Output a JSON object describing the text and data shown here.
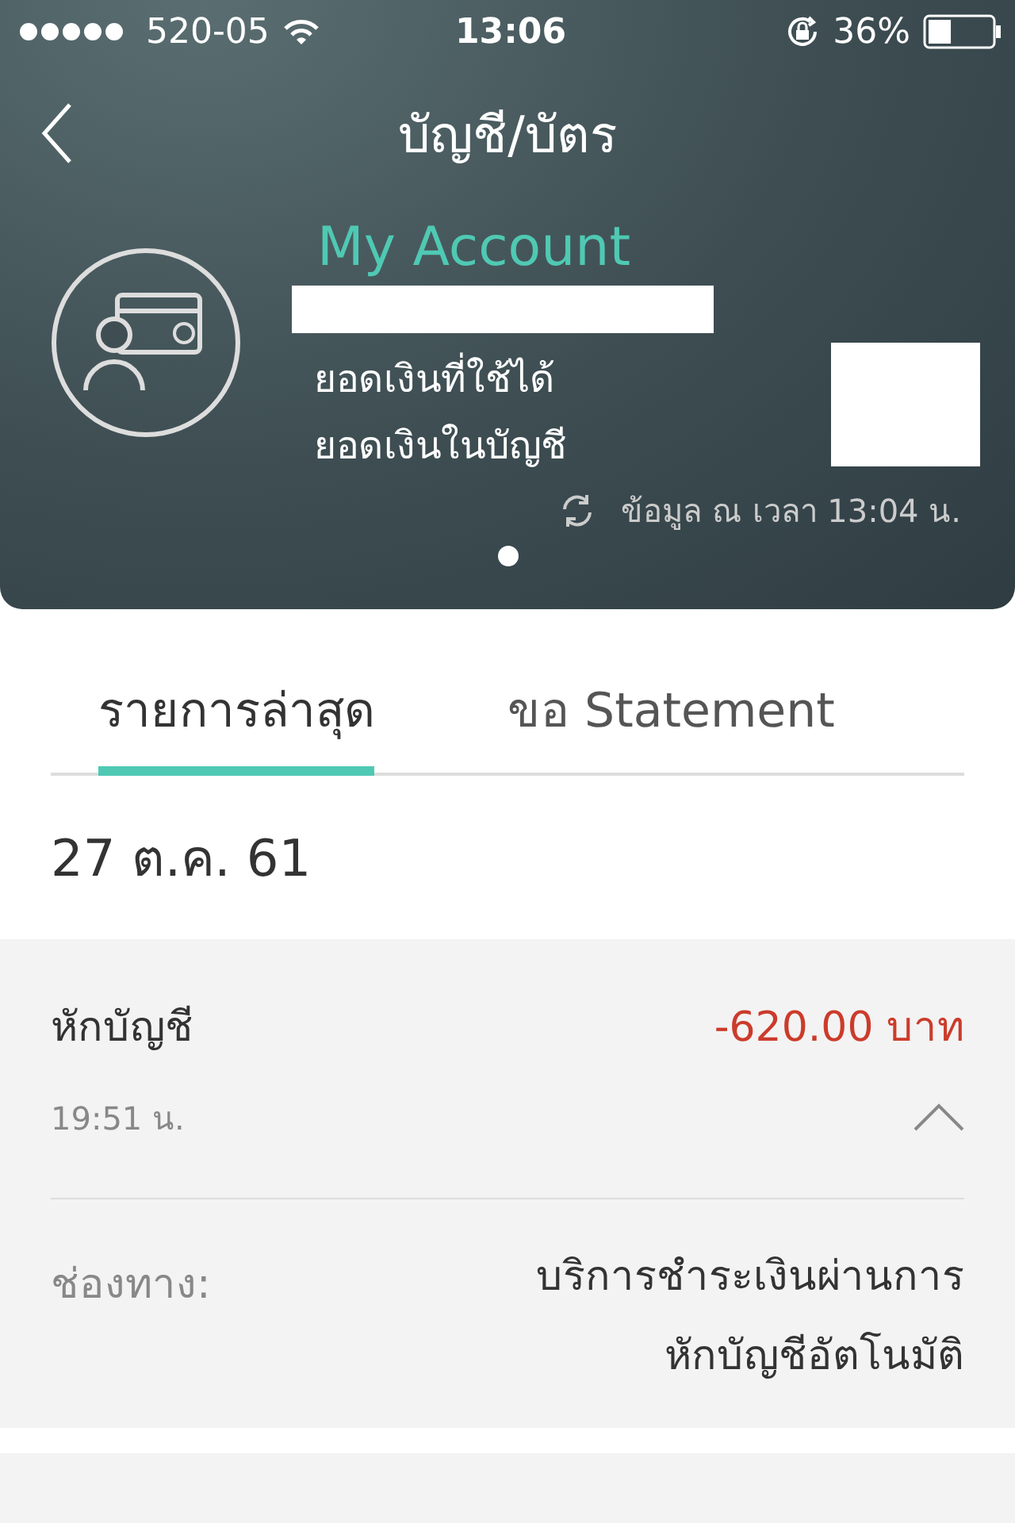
{
  "status_bar": {
    "carrier": "520-05",
    "time": "13:06",
    "battery": "36%"
  },
  "header": {
    "title": "บัญชี/บัตร"
  },
  "account": {
    "name": "My Account",
    "labels": [
      "ยอดเงินที่ใช้ได้",
      "ยอดเงินในบัญชี"
    ],
    "updated": "ข้อมูล ณ เวลา 13:04 น."
  },
  "page_dots": [
    {
      "selected": true
    }
  ],
  "tabs": [
    {
      "label": "รายการล่าสุด",
      "selected": true
    },
    {
      "label": "ขอ Statement",
      "selected": false
    }
  ],
  "date": "27 ต.ค. 61",
  "transactions": [
    {
      "title": "หักบัญชี",
      "amount": "-620.00 บาท",
      "time": "19:51 น.",
      "expanded": true,
      "details": [
        {
          "label": "ช่องทาง:",
          "value": "บริการชำระเงินผ่านการ\nหักบัญชีอัตโนมัติ"
        }
      ]
    }
  ]
}
